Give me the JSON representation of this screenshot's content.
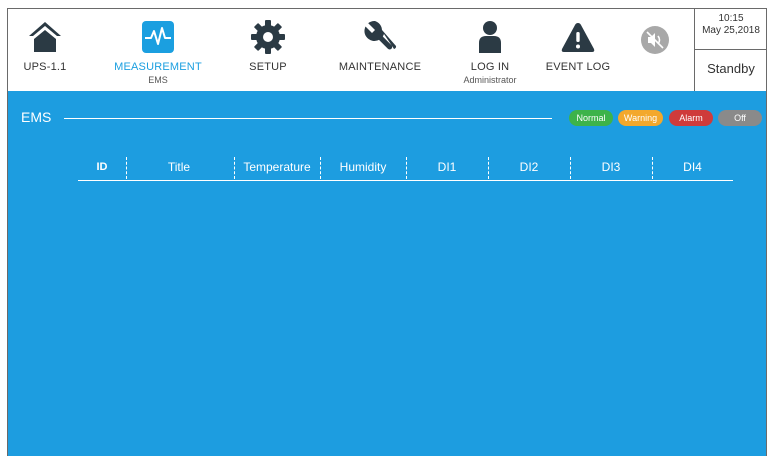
{
  "nav": {
    "ups_label": "UPS-1.1",
    "measurement_label": "MEASUREMENT",
    "measurement_sub": "EMS",
    "setup_label": "SETUP",
    "maintenance_label": "MAINTENANCE",
    "login_label": "LOG IN",
    "login_sub": "Administrator",
    "eventlog_label": "EVENT LOG"
  },
  "status": {
    "time": "10:15",
    "date": "May 25,2018",
    "state": "Standby"
  },
  "ems": {
    "title": "EMS",
    "legend": {
      "normal": "Normal",
      "warning": "Warning",
      "alarm": "Alarm",
      "off": "Off"
    },
    "columns": [
      "ID",
      "Title",
      "Temperature",
      "Humidity",
      "DI1",
      "DI2",
      "DI3",
      "DI4"
    ]
  },
  "colors": {
    "accent": "#1d9de0",
    "normal": "#3db34a",
    "warning": "#f3a82c",
    "alarm": "#cf3b3b",
    "off": "#8a8a8a",
    "icon_dark": "#2b3a44"
  },
  "icons": {
    "home": "home-icon",
    "measurement": "pulse-icon",
    "setup": "gear-icon",
    "maintenance": "wrench-icon",
    "login": "user-icon",
    "eventlog": "warning-icon",
    "mute": "speaker-mute-icon"
  }
}
